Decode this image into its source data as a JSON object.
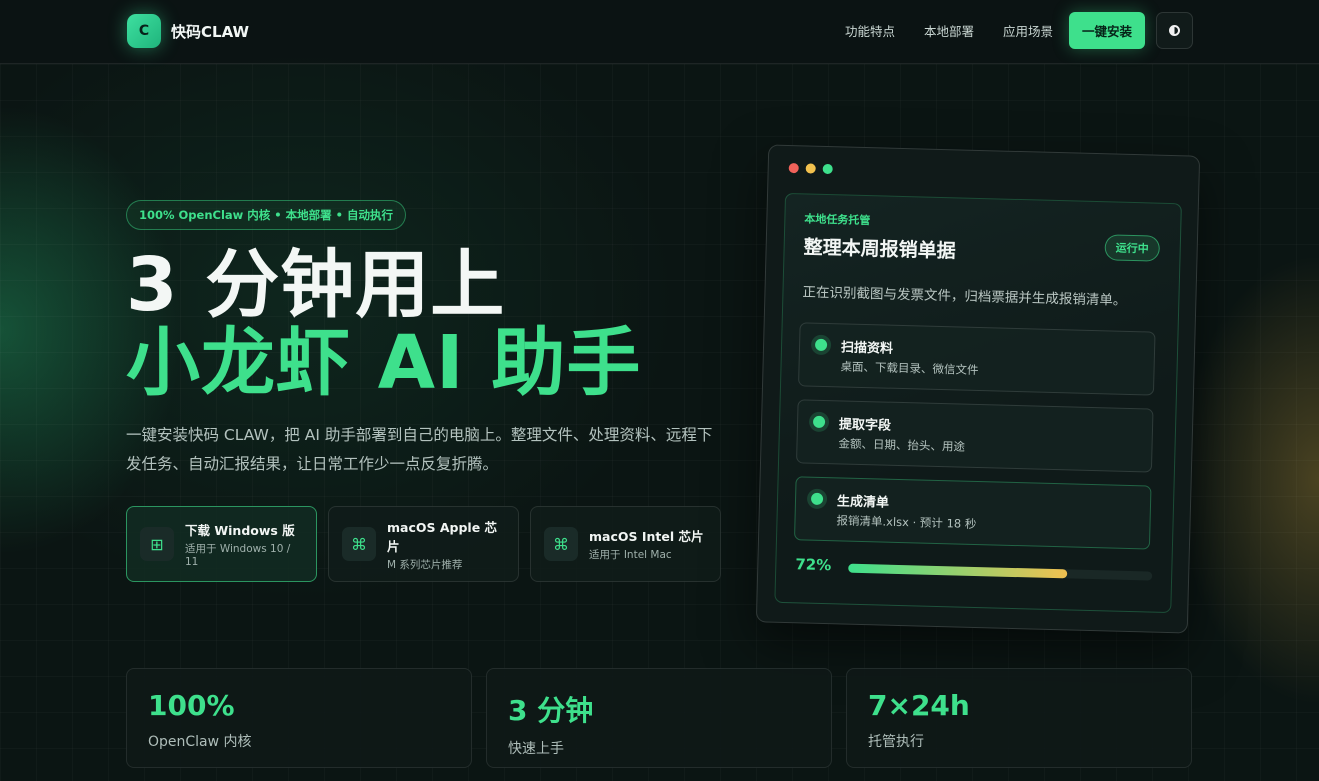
{
  "header": {
    "logo_mark": "C",
    "logo_text": "快码CLAW",
    "nav": [
      "功能特点",
      "本地部署",
      "应用场景"
    ],
    "install_label": "一键安装",
    "theme_icon": "half-circle-icon"
  },
  "hero": {
    "badge": "100% OpenClaw 内核 • 本地部署 • 自动执行",
    "title_line1": "3 分钟用上",
    "title_line2": "小龙虾 AI 助手",
    "description": "一键安装快码 CLAW，把 AI 助手部署到自己的电脑上。整理文件、处理资料、远程下发任务、自动汇报结果，让日常工作少一点反复折腾。",
    "downloads": [
      {
        "icon": "⊞",
        "title": "下载 Windows 版",
        "sub": "适用于 Windows 10 / 11"
      },
      {
        "icon": "⌘",
        "title": "macOS Apple 芯片",
        "sub": "M 系列芯片推荐"
      },
      {
        "icon": "⌘",
        "title": "macOS Intel 芯片",
        "sub": "适用于 Intel Mac"
      }
    ]
  },
  "task_window": {
    "tag": "本地任务托管",
    "title": "整理本周报销单据",
    "status": "运行中",
    "description": "正在识别截图与发票文件，归档票据并生成报销清单。",
    "steps": [
      {
        "title": "扫描资料",
        "sub": "桌面、下载目录、微信文件"
      },
      {
        "title": "提取字段",
        "sub": "金额、日期、抬头、用途"
      },
      {
        "title": "生成清单",
        "sub": "报销清单.xlsx · 预计 18 秒"
      }
    ],
    "progress_label": "72%",
    "progress_value": 0.72
  },
  "stats": [
    {
      "value": "100%",
      "label": "OpenClaw 内核"
    },
    {
      "value": "3 分钟",
      "label": "快速上手"
    },
    {
      "value": "7×24h",
      "label": "托管执行"
    }
  ],
  "colors": {
    "accent": "#3ee08c",
    "background": "#0b1513",
    "warm": "#f0c050"
  }
}
